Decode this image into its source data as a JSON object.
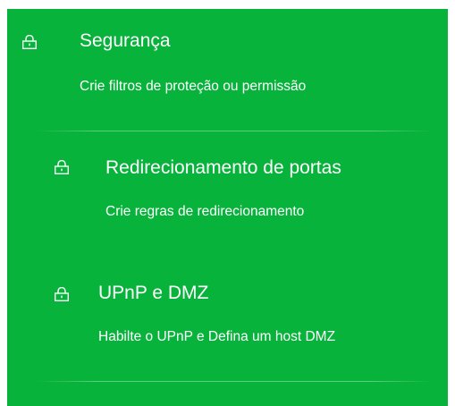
{
  "colors": {
    "panel_background": "#08b33c",
    "text": "#ffffff"
  },
  "menu": {
    "items": [
      {
        "icon": "lock-icon",
        "title": "Segurança",
        "description": "Crie filtros de proteção ou permissão"
      },
      {
        "icon": "lock-icon",
        "title": "Redirecionamento de portas",
        "description": "Crie regras de redirecionamento"
      },
      {
        "icon": "lock-icon",
        "title": "UPnP e DMZ",
        "description": "Habilte o UPnP e Defina um host DMZ"
      }
    ]
  }
}
